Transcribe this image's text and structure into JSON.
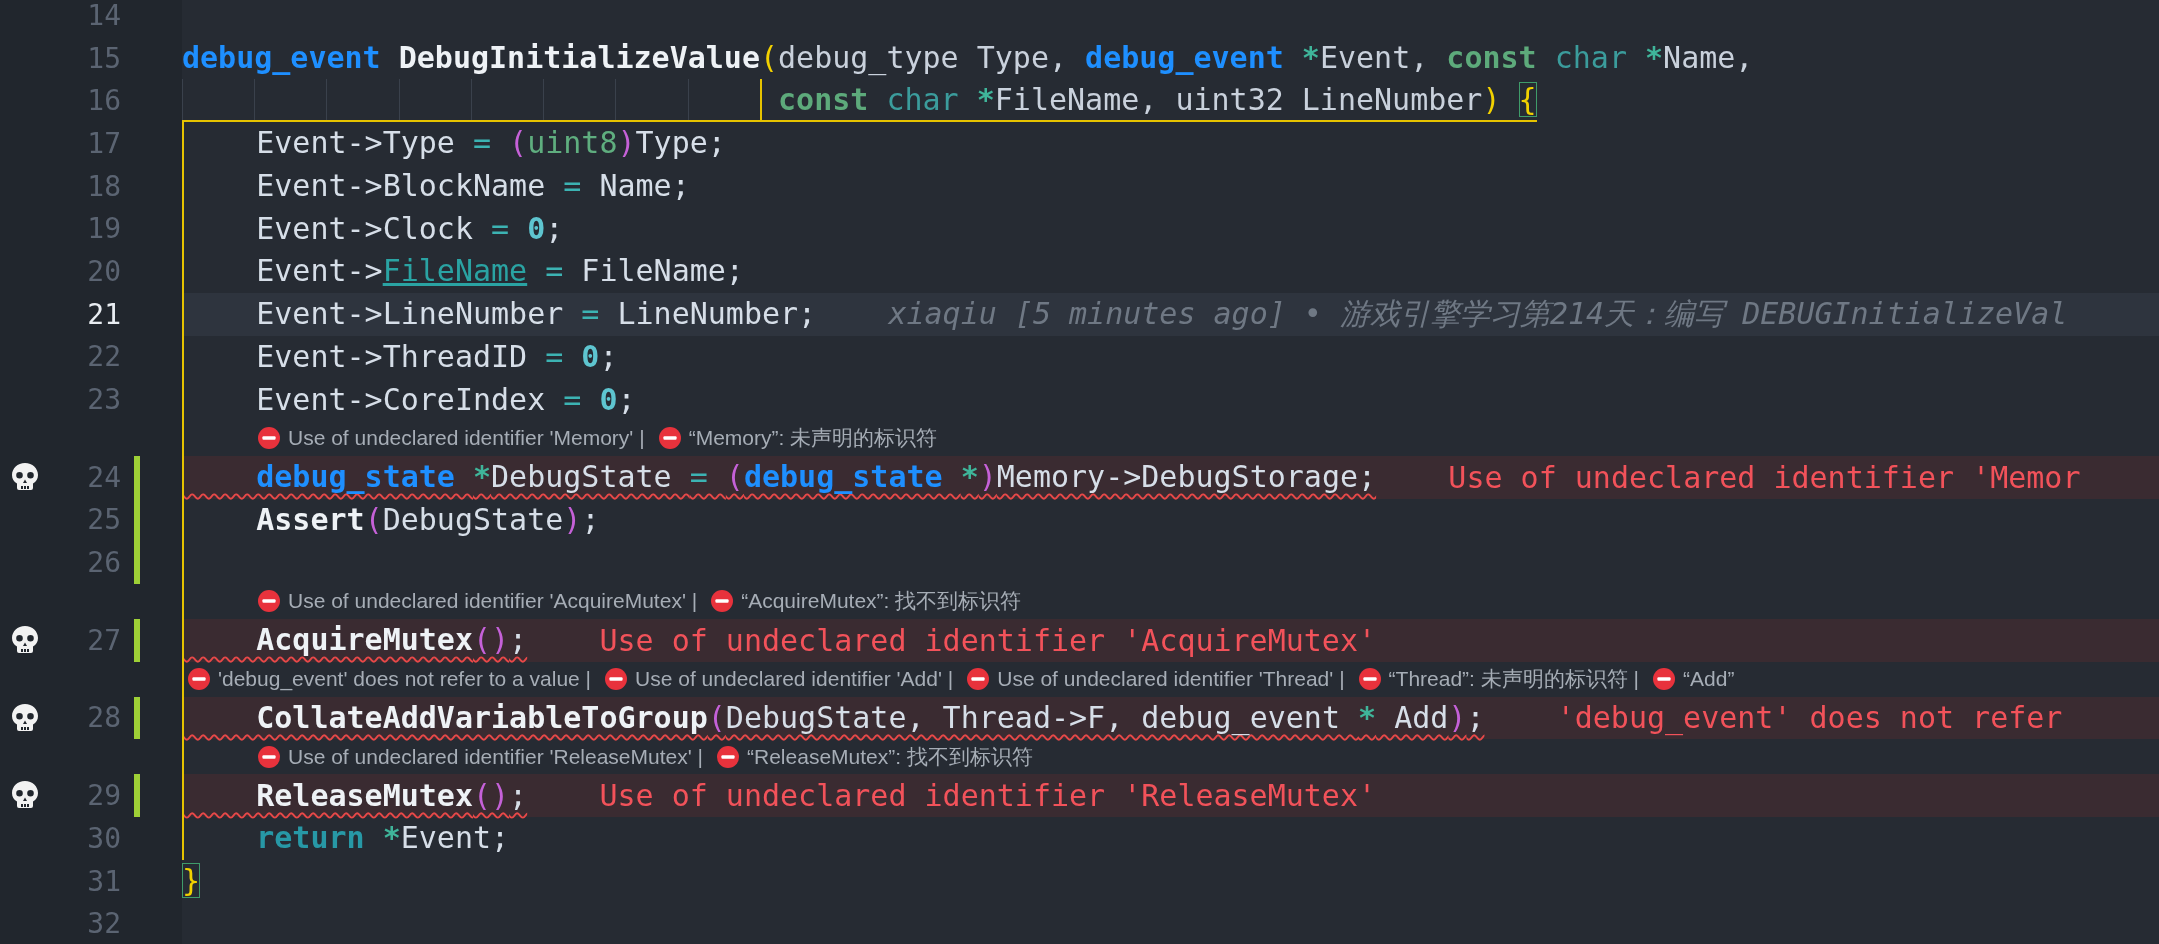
{
  "lines": [
    {
      "number": "14",
      "current": false,
      "modified": false,
      "error": false,
      "bracket_guide": false,
      "opens_bracket": false
    },
    {
      "number": "15",
      "current": false,
      "modified": false,
      "error": false,
      "bracket_guide": false,
      "opens_bracket": false,
      "tokens": [
        {
          "kind": "type",
          "text": "debug_event "
        },
        {
          "kind": "func",
          "text": "DebugInitializeValue"
        },
        {
          "kind": "paren",
          "text": "("
        },
        {
          "kind": "param",
          "text": "debug_type Type, "
        },
        {
          "kind": "type",
          "text": "debug_event "
        },
        {
          "kind": "star",
          "text": "*"
        },
        {
          "kind": "param",
          "text": "Event, "
        },
        {
          "kind": "keyword",
          "text": "const "
        },
        {
          "kind": "builtin",
          "text": "char "
        },
        {
          "kind": "star",
          "text": "*"
        },
        {
          "kind": "param",
          "text": "Name,"
        }
      ]
    },
    {
      "number": "16",
      "current": false,
      "modified": false,
      "error": false,
      "bracket_guide": false,
      "opens_bracket": true,
      "tokens": [
        {
          "kind": "keyword",
          "text": "const "
        },
        {
          "kind": "builtin",
          "text": "char "
        },
        {
          "kind": "star",
          "text": "*"
        },
        {
          "kind": "param",
          "text": "FileName, uint32 LineNumber"
        },
        {
          "kind": "paren",
          "text": ") "
        },
        {
          "kind": "brace",
          "text": "{"
        }
      ]
    },
    {
      "number": "17",
      "current": false,
      "modified": false,
      "error": false,
      "bracket_guide": true,
      "opens_bracket": false,
      "tokens": [
        {
          "kind": "plain",
          "text": "    Event->Type "
        },
        {
          "kind": "op",
          "text": "= "
        },
        {
          "kind": "paren2",
          "text": "("
        },
        {
          "kind": "typename",
          "text": "uint8"
        },
        {
          "kind": "paren2",
          "text": ")"
        },
        {
          "kind": "plain",
          "text": "Type;"
        }
      ]
    },
    {
      "number": "18",
      "current": false,
      "modified": false,
      "error": false,
      "bracket_guide": true,
      "opens_bracket": false,
      "tokens": [
        {
          "kind": "plain",
          "text": "    Event->BlockName "
        },
        {
          "kind": "op",
          "text": "="
        },
        {
          "kind": "plain",
          "text": " Name;"
        }
      ]
    },
    {
      "number": "19",
      "current": false,
      "modified": false,
      "error": false,
      "bracket_guide": true,
      "opens_bracket": false,
      "tokens": [
        {
          "kind": "plain",
          "text": "    Event->Clock "
        },
        {
          "kind": "op",
          "text": "= "
        },
        {
          "kind": "num",
          "text": "0"
        },
        {
          "kind": "plain",
          "text": ";"
        }
      ]
    },
    {
      "number": "20",
      "current": false,
      "modified": false,
      "error": false,
      "bracket_guide": true,
      "opens_bracket": false,
      "tokens": [
        {
          "kind": "plain",
          "text": "    Event->"
        },
        {
          "kind": "link",
          "text": "FileName"
        },
        {
          "kind": "op",
          "text": " ="
        },
        {
          "kind": "plain",
          "text": " FileName;"
        }
      ]
    },
    {
      "number": "21",
      "current": true,
      "modified": false,
      "error": false,
      "bracket_guide": true,
      "opens_bracket": false,
      "tokens": [
        {
          "kind": "plain",
          "text": "    Event->LineNumber "
        },
        {
          "kind": "op",
          "text": "="
        },
        {
          "kind": "plain",
          "text": " LineNumber;"
        }
      ],
      "blame": "xiaqiu [5 minutes ago] • 游戏引擎学习第214天：编写 DEBUGInitializeVal"
    },
    {
      "number": "22",
      "current": false,
      "modified": false,
      "error": false,
      "bracket_guide": true,
      "opens_bracket": false,
      "tokens": [
        {
          "kind": "plain",
          "text": "    Event->ThreadID "
        },
        {
          "kind": "op",
          "text": "= "
        },
        {
          "kind": "num",
          "text": "0"
        },
        {
          "kind": "plain",
          "text": ";"
        }
      ]
    },
    {
      "number": "23",
      "current": false,
      "modified": false,
      "error": false,
      "bracket_guide": true,
      "opens_bracket": false,
      "tokens": [
        {
          "kind": "plain",
          "text": "    Event->CoreIndex "
        },
        {
          "kind": "op",
          "text": "= "
        },
        {
          "kind": "num",
          "text": "0"
        },
        {
          "kind": "plain",
          "text": ";"
        }
      ]
    },
    {
      "number": "24",
      "current": false,
      "modified": true,
      "error": true,
      "bracket_guide": true,
      "opens_bracket": false,
      "annotation_flush": false,
      "annotations": [
        "Use of undeclared identifier 'Memory' |",
        "“Memory”: 未声明的标识符"
      ],
      "tokens": [
        {
          "kind": "type",
          "text": "    debug_state "
        },
        {
          "kind": "star",
          "text": "*"
        },
        {
          "kind": "plain",
          "text": "DebugState "
        },
        {
          "kind": "op",
          "text": "= "
        },
        {
          "kind": "paren2",
          "text": "("
        },
        {
          "kind": "type",
          "text": "debug_state "
        },
        {
          "kind": "star",
          "text": "*"
        },
        {
          "kind": "paren2",
          "text": ")"
        },
        {
          "kind": "plain",
          "text": "Memory->DebugStorage;"
        }
      ],
      "inline_message": "Use of undeclared identifier 'Memor"
    },
    {
      "number": "25",
      "current": false,
      "modified": true,
      "error": false,
      "bracket_guide": true,
      "opens_bracket": false,
      "tokens": [
        {
          "kind": "func",
          "text": "    Assert"
        },
        {
          "kind": "paren2",
          "text": "("
        },
        {
          "kind": "plain",
          "text": "DebugState"
        },
        {
          "kind": "paren2",
          "text": ")"
        },
        {
          "kind": "plain",
          "text": ";"
        }
      ]
    },
    {
      "number": "26",
      "current": false,
      "modified": true,
      "error": false,
      "bracket_guide": true,
      "opens_bracket": false
    },
    {
      "number": "27",
      "current": false,
      "modified": true,
      "error": true,
      "bracket_guide": true,
      "opens_bracket": false,
      "annotation_flush": false,
      "annotations": [
        "Use of undeclared identifier 'AcquireMutex' |",
        "“AcquireMutex”: 找不到标识符"
      ],
      "tokens": [
        {
          "kind": "func",
          "text": "    AcquireMutex"
        },
        {
          "kind": "paren2",
          "text": "()"
        },
        {
          "kind": "plain",
          "text": ";"
        }
      ],
      "inline_message": "Use of undeclared identifier 'AcquireMutex'"
    },
    {
      "number": "28",
      "current": false,
      "modified": true,
      "error": true,
      "bracket_guide": true,
      "opens_bracket": false,
      "annotation_flush": true,
      "annotations": [
        "'debug_event' does not refer to a value |",
        "Use of undeclared identifier 'Add' |",
        "Use of undeclared identifier 'Thread' |",
        "“Thread”: 未声明的标识符 |",
        "“Add”"
      ],
      "tokens": [
        {
          "kind": "func",
          "text": "    CollateAddVariableToGroup"
        },
        {
          "kind": "paren2",
          "text": "("
        },
        {
          "kind": "plain",
          "text": "DebugState, Thread->F, debug_event "
        },
        {
          "kind": "star",
          "text": "*"
        },
        {
          "kind": "plain",
          "text": " Add"
        },
        {
          "kind": "paren2",
          "text": ")"
        },
        {
          "kind": "plain",
          "text": ";"
        }
      ],
      "inline_message": "'debug_event' does not refer"
    },
    {
      "number": "29",
      "current": false,
      "modified": true,
      "error": true,
      "bracket_guide": true,
      "opens_bracket": false,
      "annotation_flush": false,
      "annotations": [
        "Use of undeclared identifier 'ReleaseMutex' |",
        "“ReleaseMutex”: 找不到标识符"
      ],
      "tokens": [
        {
          "kind": "func",
          "text": "    ReleaseMutex"
        },
        {
          "kind": "paren2",
          "text": "()"
        },
        {
          "kind": "plain",
          "text": ";"
        }
      ],
      "inline_message": "Use of undeclared identifier 'ReleaseMutex'"
    },
    {
      "number": "30",
      "current": false,
      "modified": false,
      "error": false,
      "bracket_guide": true,
      "opens_bracket": false,
      "tokens": [
        {
          "kind": "return",
          "text": "    return "
        },
        {
          "kind": "star",
          "text": "*"
        },
        {
          "kind": "plain",
          "text": "Event;"
        }
      ]
    },
    {
      "number": "31",
      "current": false,
      "modified": false,
      "error": false,
      "bracket_guide": false,
      "opens_bracket": false,
      "tokens": [
        {
          "kind": "brace",
          "text": "}"
        }
      ]
    },
    {
      "number": "32",
      "current": false,
      "modified": false,
      "error": false,
      "bracket_guide": false,
      "opens_bracket": false
    }
  ]
}
